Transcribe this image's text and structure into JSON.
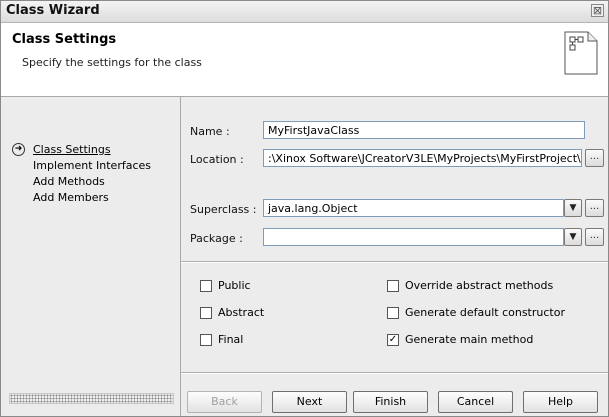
{
  "window": {
    "title": "Class Wizard",
    "close_glyph": "⊠"
  },
  "header": {
    "title": "Class Settings",
    "subtitle": "Specify the settings for the class",
    "icon": "class-document-icon"
  },
  "steps": [
    {
      "label": "Class Settings",
      "active": true
    },
    {
      "label": "Implement Interfaces",
      "active": false
    },
    {
      "label": "Add Methods",
      "active": false
    },
    {
      "label": "Add Members",
      "active": false
    }
  ],
  "form": {
    "name_label": "Name :",
    "name_value": "MyFirstJavaClass",
    "location_label": "Location :",
    "location_value": ":\\Xinox Software\\JCreatorV3LE\\MyProjects\\MyFirstProject\\",
    "browse_label": "...",
    "superclass_label": "Superclass :",
    "superclass_value": "java.lang.Object",
    "package_label": "Package :",
    "package_value": ""
  },
  "options": {
    "public": {
      "label": "Public",
      "checked": false
    },
    "abstract": {
      "label": "Abstract",
      "checked": false
    },
    "final": {
      "label": "Final",
      "checked": false
    },
    "override_abstract": {
      "label": "Override abstract methods",
      "checked": false
    },
    "default_constructor": {
      "label": "Generate default constructor",
      "checked": false
    },
    "main_method": {
      "label": "Generate main method",
      "checked": true
    }
  },
  "buttons": {
    "back": "Back",
    "next": "Next",
    "finish": "Finish",
    "cancel": "Cancel",
    "help": "Help"
  }
}
